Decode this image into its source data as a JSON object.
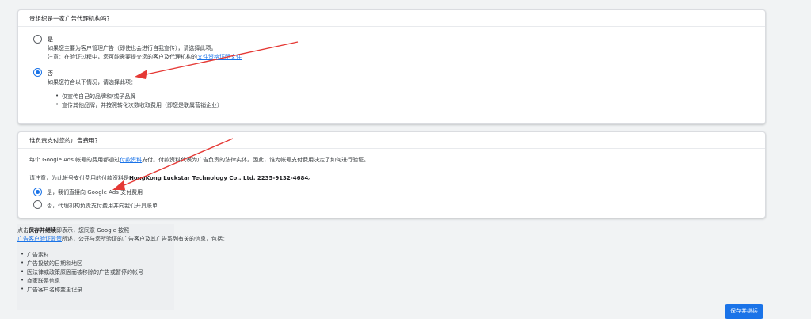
{
  "q1": {
    "title": "贵组织是一家广告代理机构吗？",
    "opt_yes": {
      "label": "是",
      "desc1": "如果您主要为客户管理广告（即使也会进行自我宣传），请选择此项。",
      "desc2_pre": "注意：在验证过程中，您可能需要提交您的客户及代理机构的",
      "desc2_link": "文件资格证明文件"
    },
    "opt_no": {
      "label": "否",
      "desc": "如果您符合以下情况，请选择此项：",
      "bullets": [
        "仅宣传自己的品牌和/或子品牌",
        "宣传其他品牌，并按照转化次数收取费用（即您是联属营销企业）"
      ]
    }
  },
  "q2": {
    "title": "谁负责支付您的广告费用？",
    "info_pre": "每个 Google Ads 帐号的费用都通过",
    "info_link": "付款资料",
    "info_post": "支付。付款资料代表为广告负责的法律实体。因此，谁为帐号支付费用决定了如何进行验证。",
    "note_pre": "请注意，为此帐号支付费用的付款资料是",
    "note_bold": "HongKong Luckstar Technology Co., Ltd. 2235-9132-4684。",
    "opt_direct": "是，我们直接向 Google Ads 支付费用",
    "opt_agency": "否，代理机构负责支付费用并向我们开具账单"
  },
  "footer": {
    "line1_pre": "点击",
    "line1_bold": "保存并继续",
    "line1_post": "即表示，您同意 Google 按照",
    "line2_link": "广告客户验证政策",
    "line2_post": "所述，公开与您所验证的广告客户及其广告系列有关的信息，包括：",
    "bullets": [
      "广告素材",
      "广告投放的日期和地区",
      "因法律或政策原因而被移除的广告或暂停的帐号",
      "商家联系信息",
      "广告客户名称变更记录"
    ]
  },
  "save_button": "保存并继续",
  "colors": {
    "accent": "#1a73e8",
    "arrow": "#e53935"
  }
}
